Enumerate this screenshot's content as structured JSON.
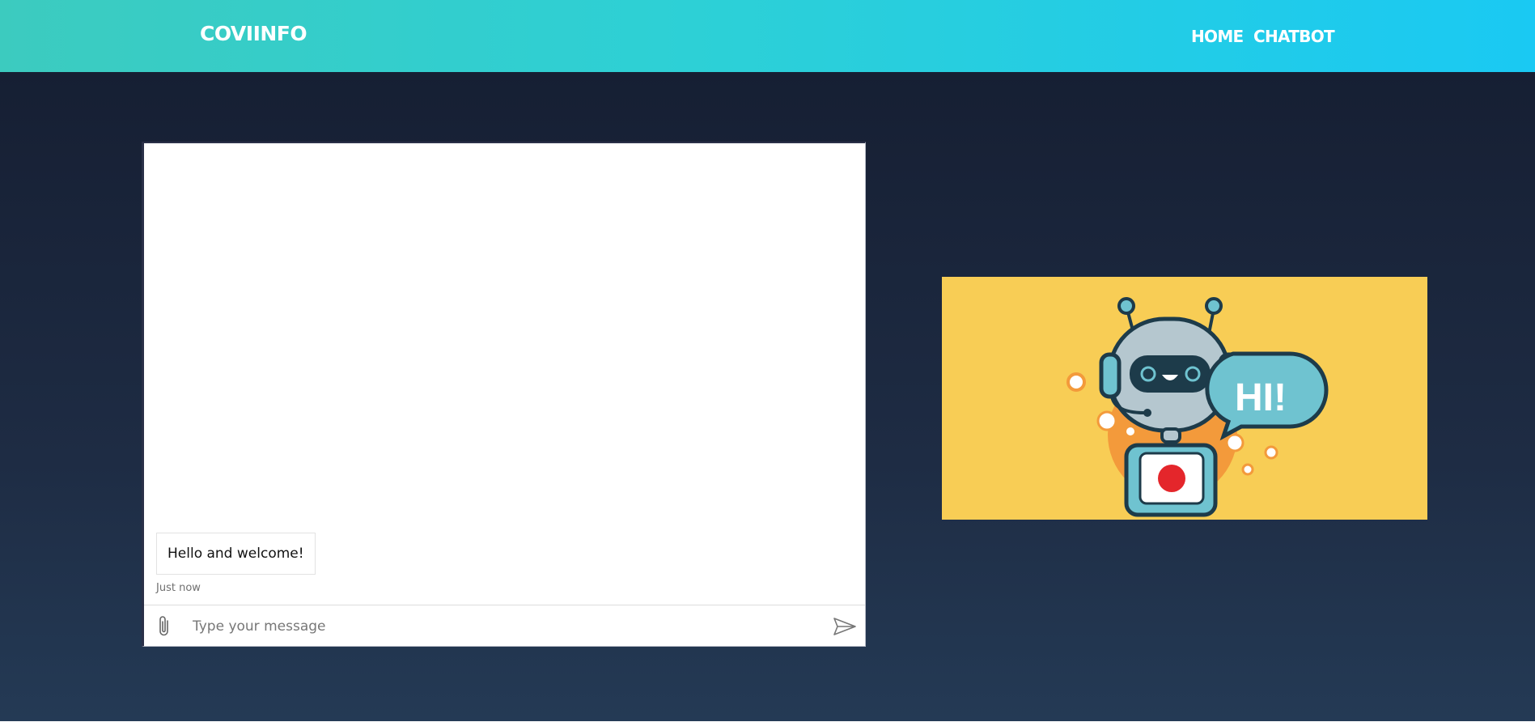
{
  "nav": {
    "brand": "COVIINFO",
    "links": [
      "HOME",
      "CHATBOT"
    ]
  },
  "chat": {
    "messages": [
      {
        "text": "Hello and welcome!",
        "time": "Just now"
      }
    ],
    "input_placeholder": "Type your message",
    "icons": {
      "attach": "paperclip-icon",
      "send": "send-icon"
    }
  },
  "banner": {
    "graphic": "chatbot-robot-illustration",
    "speech_text": "HI!",
    "background_color": "#f8cd55"
  },
  "colors": {
    "nav_gradient_start": "#3ccbbf",
    "nav_gradient_end": "#1ac9f3",
    "page_background": "#1e2c44"
  }
}
